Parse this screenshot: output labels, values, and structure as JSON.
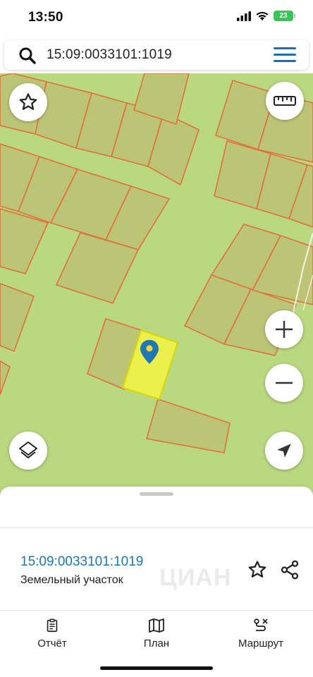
{
  "status": {
    "time": "13:50",
    "battery": "23"
  },
  "search": {
    "query": "15:09:0033101:1019",
    "search_icon": "search-icon",
    "menu_icon": "hamburger-menu-icon"
  },
  "map": {
    "colors": {
      "background": "#b9d880",
      "parcel_fill": "#bcc575",
      "parcel_stroke": "#e0703c",
      "selected_fill": "#eef24a",
      "selected_stroke": "#d8d800",
      "pin": "#1f78b4"
    },
    "controls": [
      "star-icon",
      "ruler-icon",
      "zoom-in-icon",
      "zoom-out-icon",
      "layers-icon",
      "location-arrow-icon"
    ]
  },
  "sheet": {
    "parcel_number": "15:09:0033101:1019",
    "parcel_type": "Земельный участок",
    "watermark": "ЦИАН"
  },
  "tabs": [
    {
      "label": "Отчёт",
      "icon": "report-icon"
    },
    {
      "label": "План",
      "icon": "map-plan-icon"
    },
    {
      "label": "Маршрут",
      "icon": "route-icon"
    }
  ]
}
